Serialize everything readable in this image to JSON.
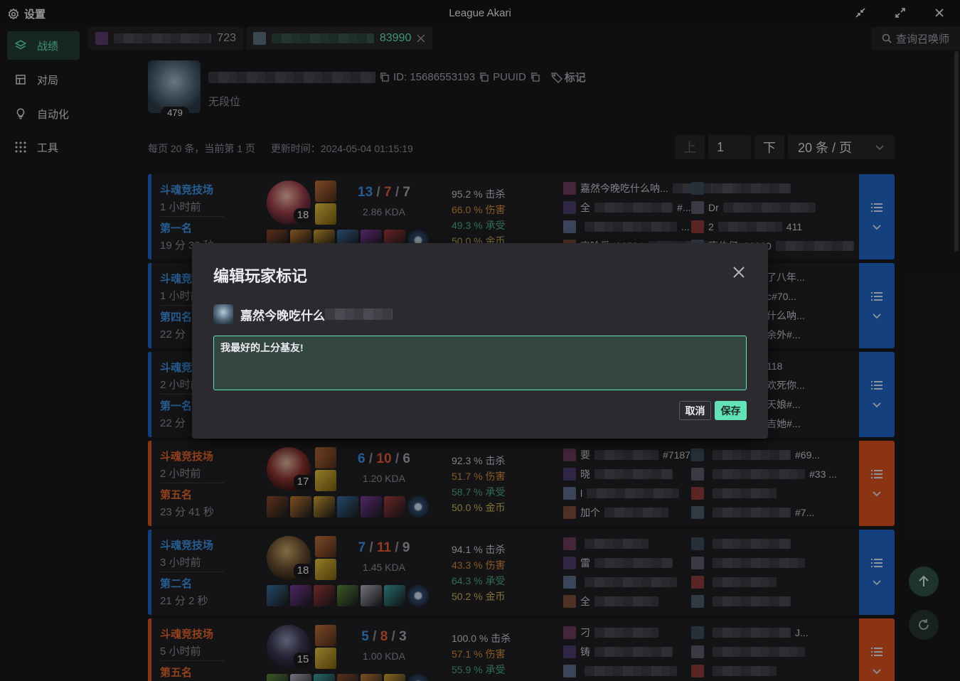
{
  "window": {
    "settings_label": "设置",
    "title": "League Akari",
    "minimize_icon": "shrink-icon",
    "maximize_icon": "expand-icon",
    "close_icon": "close-icon"
  },
  "sidebar": {
    "items": [
      {
        "label": "战绩",
        "icon": "layers-icon",
        "active": true
      },
      {
        "label": "对局",
        "icon": "layout-icon",
        "active": false
      },
      {
        "label": "自动化",
        "icon": "bulb-icon",
        "active": false
      },
      {
        "label": "工具",
        "icon": "grid-icon",
        "active": false
      }
    ]
  },
  "tabs": [
    {
      "suffix": "723",
      "active": false
    },
    {
      "suffix": "83990",
      "active": true
    }
  ],
  "search": {
    "label": "查询召唤师"
  },
  "profile": {
    "level": "479",
    "id_text": "ID: 15686553193",
    "puuid_label": "PUUID",
    "tag_label": "标记",
    "rank": "无段位"
  },
  "paging": {
    "per_page_text": "每页 20 条，当前第 1 页",
    "updated_text": "更新时间：2024-05-04 01:15:19",
    "prev": "上",
    "page": "1",
    "next": "下",
    "page_size": "20 条 / 页"
  },
  "matches": [
    {
      "result": "win",
      "mode": "斗魂竞技场",
      "ago": "1 小时前",
      "place": "第一名",
      "duration": "19 分 32 秒",
      "level": "18",
      "k": "13",
      "d": "7",
      "a": "7",
      "kda": "2.86 KDA",
      "kill": "95.2 % 击杀",
      "damage": "66.0 % 伤害",
      "taken": "49.3 % 承受",
      "gold": "50.0 % 金币",
      "players": [
        "嘉然今晚吃什么呐...",
        "全",
        "",
        "高哈爱#20524",
        "",
        "Dr",
        "2",
        "唐伯仔#33380"
      ],
      "player_tails": [
        "",
        "#...",
        "...",
        "",
        "",
        "",
        "411",
        ""
      ]
    },
    {
      "result": "win",
      "mode": "斗魂竞技场",
      "ago": "1 小时前",
      "place": "第四名",
      "duration": "22 分",
      "right_names": [
        "了八年...",
        "c#70...",
        "什么呐...",
        "余外#..."
      ]
    },
    {
      "result": "win",
      "mode": "斗魂竞技场",
      "ago": "2 小时前",
      "place": "第一名",
      "duration": "22 分",
      "right_names": [
        "118",
        "欢死你...",
        "天娘#...",
        "吉她#..."
      ]
    },
    {
      "result": "lose",
      "mode": "斗魂竞技场",
      "ago": "2 小时前",
      "place": "第五名",
      "duration": "23 分 41 秒",
      "level": "17",
      "k": "6",
      "d": "10",
      "a": "6",
      "kda": "1.20 KDA",
      "kill": "92.3 % 击杀",
      "damage": "51.7 % 伤害",
      "taken": "58.7 % 承受",
      "gold": "50.0 % 金币",
      "players": [
        "要",
        "晓",
        "l",
        "加个",
        "",
        "",
        "",
        ""
      ],
      "player_tails": [
        "#71875",
        "",
        "",
        "",
        "#69...",
        "#33 ...",
        "",
        "#7..."
      ]
    },
    {
      "result": "win",
      "mode": "斗魂竞技场",
      "ago": "3 小时前",
      "place": "第二名",
      "duration": "21 分 2 秒",
      "level": "18",
      "k": "7",
      "d": "11",
      "a": "9",
      "kda": "1.45 KDA",
      "kill": "94.1 % 击杀",
      "damage": "43.3 % 伤害",
      "taken": "64.3 % 承受",
      "gold": "50.2 % 金币",
      "players": [
        "",
        "雷",
        "",
        "全",
        "",
        "",
        "",
        ""
      ],
      "player_tails": [
        "",
        "",
        "",
        "",
        "",
        "",
        "",
        ""
      ]
    },
    {
      "result": "lose",
      "mode": "斗魂竞技场",
      "ago": "5 小时前",
      "place": "第五名",
      "duration": "",
      "level": "15",
      "k": "5",
      "d": "8",
      "a": "3",
      "kda": "1.00 KDA",
      "kill": "100.0 % 击杀",
      "damage": "57.1 % 伤害",
      "taken": "55.9 % 承受",
      "gold": "",
      "players": [
        "刁",
        "铸",
        "",
        "",
        "",
        "",
        "",
        ""
      ],
      "player_tails": [
        "",
        "",
        "",
        "",
        "J...",
        "",
        "",
        ""
      ]
    }
  ],
  "modal": {
    "title": "编辑玩家标记",
    "user_name": "嘉然今晚吃什么",
    "note": "我最好的上分基友!",
    "cancel": "取消",
    "save": "保存"
  },
  "colors": {
    "accent": "#63e2b7",
    "win": "#1f63c2",
    "lose": "#d6501e",
    "background": "#18181b"
  }
}
